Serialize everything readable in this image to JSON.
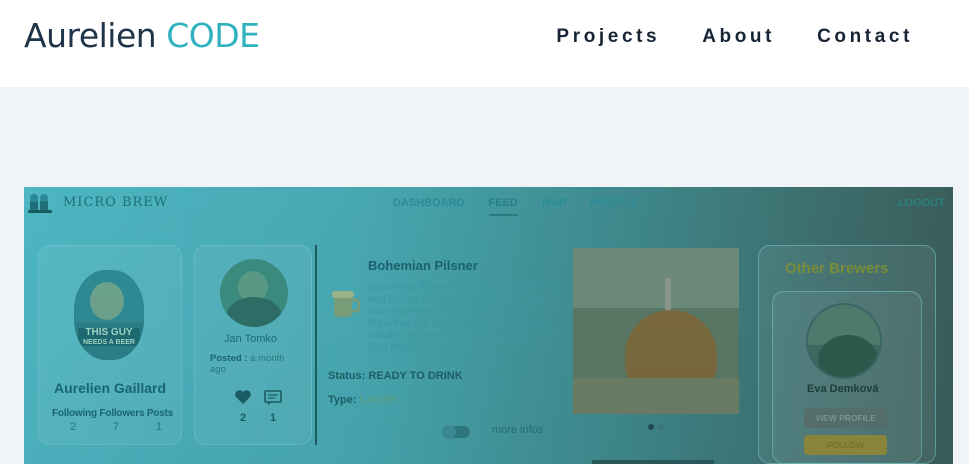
{
  "site": {
    "logo_main": "Aurelien",
    "logo_accent": "CODE",
    "nav": [
      "Projects",
      "About",
      "Contact"
    ]
  },
  "app": {
    "name": "MICRO BREW",
    "nav": [
      "DASHBOARD",
      "FEED",
      "MAP",
      "PROFILE"
    ],
    "active_tab": "FEED",
    "logout": "LOGOUT",
    "profile": {
      "avatar_caption_1": "THIS GUY",
      "avatar_caption_2": "NEEDS A BEER",
      "name": "Aurelien Gaillard",
      "stats_labels": "Following Followers Posts",
      "following": "2",
      "followers": "7",
      "posts": "1"
    },
    "post": {
      "author": "Jan Tomko",
      "posted_label": "Posted :",
      "posted_value": " a month ago",
      "likes": "2",
      "comments": "1",
      "beer_title": "Bohemian Pilsner",
      "description": "Bohemian Pilsner is a light, easy-drinking and typical Czech pilsner. Round, soft malt character and taste from the Saaz hops that are typical of this style. Food: suitable for shellfish, chicken, salad, mild light cheeses",
      "status_label": "Status:",
      "status_value": "READY TO DRINK",
      "type_label": "Type:",
      "type_value": "LAGER",
      "more_infos": "more infos"
    },
    "other_brewers": {
      "title": "Other Brewers",
      "name": "Eva Demková",
      "view_profile": "VIEW PROFILE",
      "follow": "FOLLOW"
    }
  },
  "colors": {
    "accent": "#2fb1be",
    "logo_dark": "#1f3448",
    "page_bg": "#f0f4f8"
  }
}
